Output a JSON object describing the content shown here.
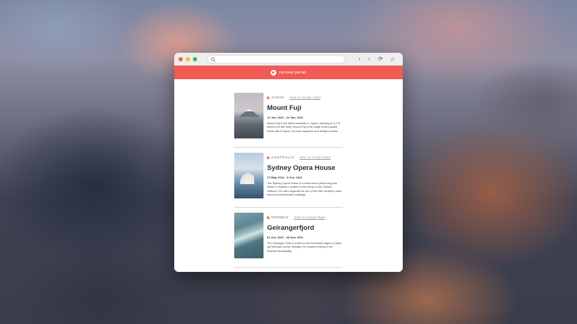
{
  "app": {
    "brand": "my travel journal."
  },
  "browser": {
    "url_placeholder": "",
    "back_icon": "chevron-left",
    "forward_icon": "chevron-right",
    "reload_icon": "reload",
    "home_icon": "home"
  },
  "colors": {
    "brand_red": "#f25a55"
  },
  "entries": [
    {
      "country": "JAPAN",
      "map_link": "View on Google Maps",
      "title": "Mount Fuji",
      "dates": "12 Jan, 2021 - 24 Jan, 2021",
      "description": "Mount Fuji is the tallest mountain in Japan, standing at 3,776 meters (12,380 feet). Mount Fuji is the single most popular tourist site in Japan, for both Japanese and foreign tourists."
    },
    {
      "country": "AUSTRALIA",
      "map_link": "View on Google Maps",
      "title": "Sydney Opera House",
      "dates": "27 May, 2021 - 8 Jun, 2021",
      "description": "The Sydney Opera House is a multi-venue performing arts centre in Sydney. Located on the banks of the Sydney Harbour, it is often regarded as one of the 20th century's most famous and distinctive buildings"
    },
    {
      "country": "NORWAY",
      "map_link": "View on Google Maps",
      "title": "Geirangerfjord",
      "dates": "01 Oct, 2021 - 18 Nov, 2021",
      "description": "The Geiranger Fjord is a fjord in the Sunnmøre region of Møre og Romsdal county, Norway. It is located entirely in the Stranda Municipality."
    }
  ]
}
